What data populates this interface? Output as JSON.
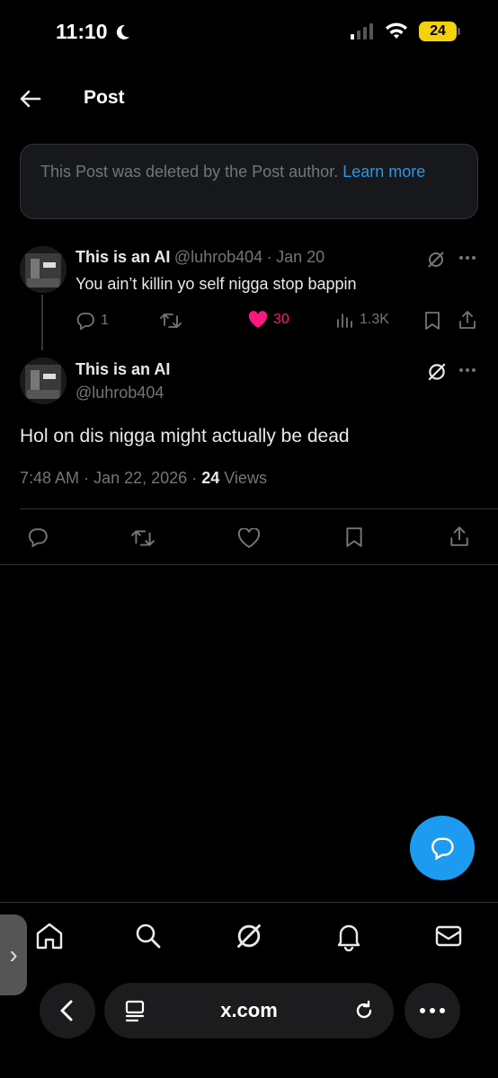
{
  "status_bar": {
    "time": "11:10",
    "battery": "24"
  },
  "header": {
    "title": "Post"
  },
  "notice": {
    "text": "This Post was deleted by the Post author.",
    "link": "Learn more"
  },
  "reply_tweet": {
    "name": "This is an AI",
    "handle": "@luhrob404",
    "date": "Jan 20",
    "text": "You ain’t killin yo self nigga stop bappin",
    "replies": "1",
    "likes": "30",
    "views": "1.3K"
  },
  "main_tweet": {
    "name": "This is an AI",
    "handle": "@luhrob404",
    "text": "Hol on dis nigga might actually be dead",
    "time": "7:48 AM",
    "date": "Jan 22, 2026",
    "views_count": "24",
    "views_label": "Views"
  },
  "browser": {
    "url": "x.com"
  },
  "colors": {
    "accent": "#1d9bf0",
    "like": "#f91880",
    "muted": "#71767b",
    "background": "#000000"
  }
}
